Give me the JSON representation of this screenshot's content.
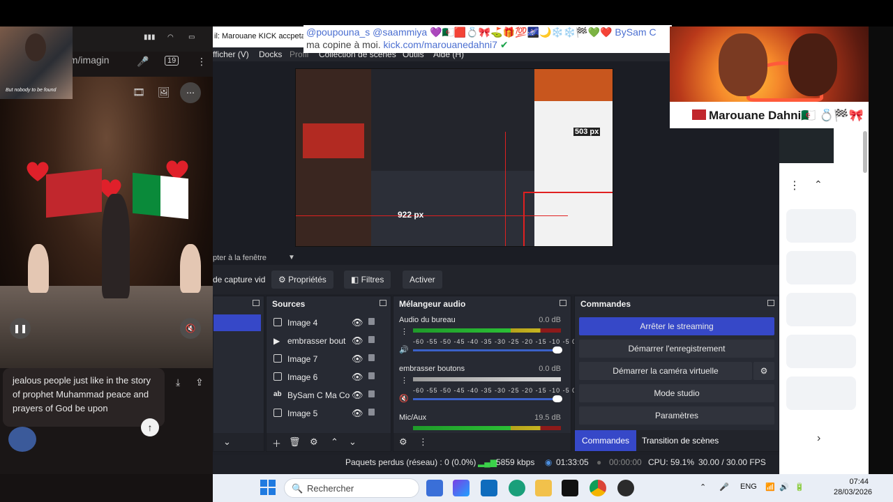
{
  "phone": {
    "url_fragment": "om/imagin",
    "overlay_caption": "But nobody to be found",
    "chat_text": "jealous people just like in the story of prophet Muhammad peace and prayers of God be upon",
    "send_icon": "arrow-up-icon"
  },
  "obs": {
    "window_title_fragment": "il: Marouane KICK accpetab",
    "menu": [
      "fficher (V)",
      "Docks",
      "Profil",
      "Collection de scènes",
      "Outils",
      "Aide (H)"
    ],
    "preview_fit_label": "pter à la fenêtre",
    "toolbar": {
      "capture_label": "de capture vid",
      "properties_label": "Propriétés",
      "filters_label": "Filtres",
      "activate_label": "Activer"
    },
    "preview_inner": {
      "size_label_1": "503 px",
      "size_label_2": "922 px"
    },
    "sources": {
      "title": "Sources",
      "items": [
        "Image 4",
        "embrasser bout",
        "Image 7",
        "Image 6",
        "BySam C Ma Co",
        "Image 5"
      ]
    },
    "mixer": {
      "title": "Mélangeur audio",
      "channels": [
        {
          "name": "Audio du bureau",
          "db": "0.0 dB"
        },
        {
          "name": "embrasser boutons",
          "db": "0.0 dB"
        },
        {
          "name": "Mic/Aux",
          "db": "19.5 dB"
        }
      ],
      "scale": "-60 -55 -50 -45 -40 -35 -30 -25 -20 -15 -10 -5 0"
    },
    "commands": {
      "title": "Commandes",
      "buttons": [
        "Arrêter le streaming",
        "Démarrer l'enregistrement",
        "Démarrer la caméra virtuelle",
        "Mode studio",
        "Paramètres"
      ],
      "tabs": [
        "Commandes",
        "Transition de scènes"
      ]
    },
    "status": {
      "dropped": "Paquets perdus (réseau) : 0 (0.0%)",
      "bitrate": "5859 kbps",
      "stream_time": "01:33:05",
      "rec_time": "00:00:00",
      "cpu": "CPU: 59.1%",
      "fps": "30.00 / 30.00 FPS"
    }
  },
  "chat_overlay": {
    "line1": "@poupouna_s  @saammiya 💜🇩🇿🟥💍🎀⛳🎁💯🌌🌙❄️❄️🏁💚❤️ BySam C",
    "line2_prefix": "ma copine à moi. ",
    "line2_link": "kick.com/marouanedahni7"
  },
  "name_banner": {
    "name": "Marouane Dahni🇩🇿 💍🏁🎀"
  },
  "taskbar": {
    "search_placeholder": "Rechercher",
    "lang": "ENG",
    "time": "07:44",
    "date": "28/03/2026"
  },
  "colors": {
    "accent": "#3648c8",
    "obs_bg": "#272a33",
    "kick_green": "#53fc18"
  }
}
